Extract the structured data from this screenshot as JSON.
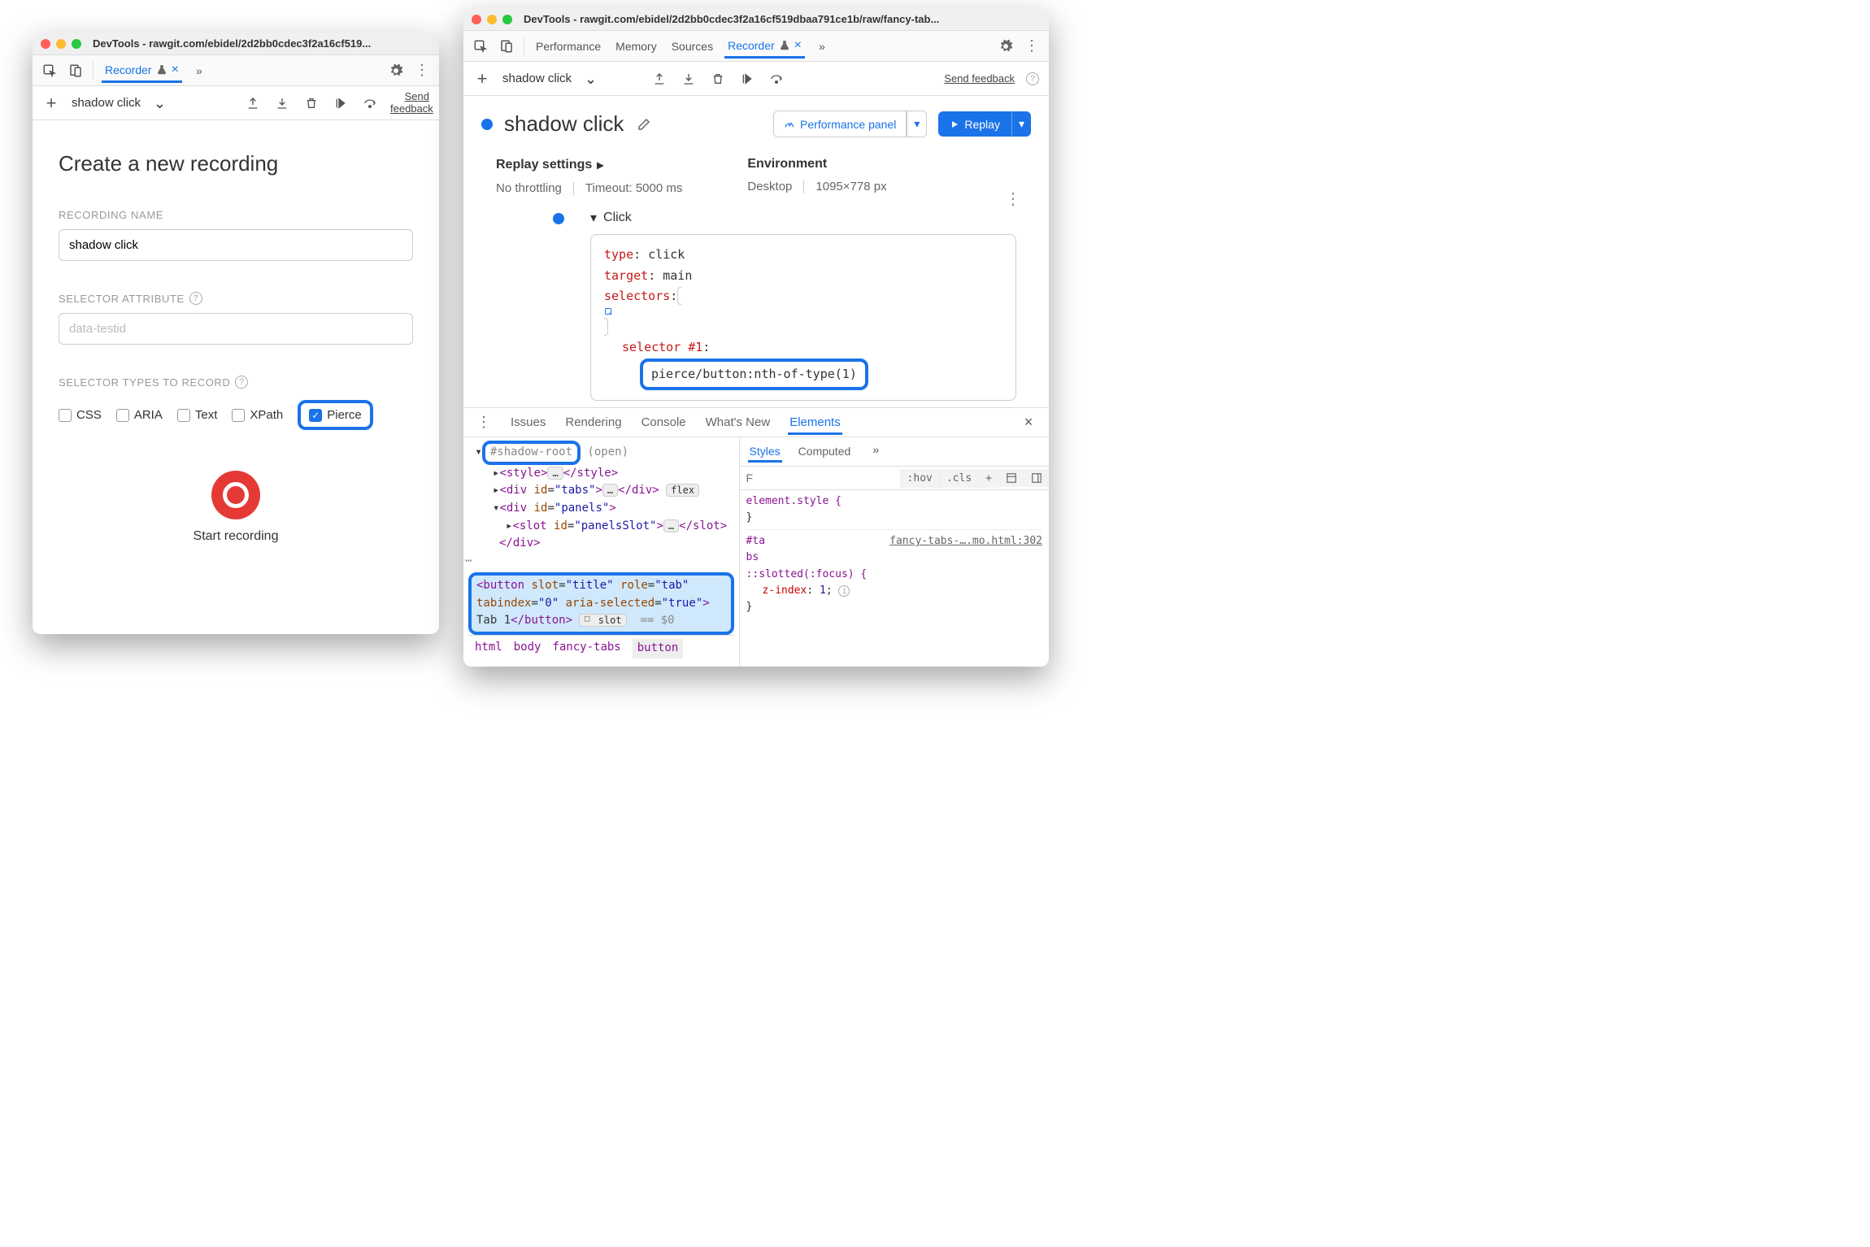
{
  "left": {
    "title": "DevTools - rawgit.com/ebidel/2d2bb0cdec3f2a16cf519...",
    "tabs": {
      "recorder": "Recorder"
    },
    "toolbar": {
      "recording_name": "shadow click",
      "send_feedback": "Send feedback"
    },
    "form": {
      "heading": "Create a new recording",
      "recording_name_label": "RECORDING NAME",
      "recording_name_value": "shadow click",
      "selector_attribute_label": "SELECTOR ATTRIBUTE",
      "selector_attribute_placeholder": "data-testid",
      "selector_types_label": "SELECTOR TYPES TO RECORD",
      "types": {
        "css": "CSS",
        "aria": "ARIA",
        "text": "Text",
        "xpath": "XPath",
        "pierce": "Pierce"
      },
      "start_label": "Start recording"
    }
  },
  "right": {
    "title": "DevTools - rawgit.com/ebidel/2d2bb0cdec3f2a16cf519dbaa791ce1b/raw/fancy-tab...",
    "tabs": {
      "performance": "Performance",
      "memory": "Memory",
      "sources": "Sources",
      "recorder": "Recorder"
    },
    "toolbar": {
      "recording_name": "shadow click",
      "send_feedback": "Send feedback"
    },
    "header": {
      "name": "shadow click",
      "perf_panel": "Performance panel",
      "replay": "Replay"
    },
    "settings": {
      "replay_heading": "Replay settings",
      "throttling": "No throttling",
      "timeout": "Timeout: 5000 ms",
      "env_heading": "Environment",
      "env_device": "Desktop",
      "env_dims": "1095×778 px"
    },
    "step": {
      "title": "Click",
      "type_k": "type",
      "type_v": "click",
      "target_k": "target",
      "target_v": "main",
      "selectors_k": "selectors",
      "selector1_k": "selector #1",
      "selector1_v": "pierce/button:nth-of-type(1)"
    },
    "drawer": {
      "tabs": {
        "issues": "Issues",
        "rendering": "Rendering",
        "console": "Console",
        "whats_new": "What's New",
        "elements": "Elements"
      },
      "dom": {
        "shadow_root": "#shadow-root",
        "open": "(open)",
        "style_tag": "<style>",
        "style_close": "</style>",
        "div_tabs_open": "<div id=\"tabs\">",
        "div_tabs_close": "</div>",
        "flex_pill": "flex",
        "div_panels_open": "<div id=\"panels\">",
        "slot_open": "<slot id=\"panelsSlot\">",
        "slot_close": "</slot>",
        "div_close": "</div>",
        "button_line1": "<button slot=\"title\" role=\"tab\" tabindex=\"0\" aria-selected=\"true\">",
        "button_text": "Tab 1",
        "button_close": "</button>",
        "slot_pill": "slot",
        "dollar0": "== $0"
      },
      "crumbs": {
        "html": "html",
        "body": "body",
        "fancy_tabs": "fancy-tabs",
        "button": "button"
      },
      "styles": {
        "tabs": {
          "styles": "Styles",
          "computed": "Computed"
        },
        "filter_placeholder": "F",
        "hov": ":hov",
        "cls": ".cls",
        "element_style": "element.style {",
        "close": "}",
        "rule_sel_prefix": "#ta",
        "rule_sel_suffix": "bs",
        "src": "fancy-tabs-….mo.html:302",
        "slotted": "::slotted(:focus) {",
        "zindex_prop": "z-index",
        "zindex_val": "1"
      }
    }
  }
}
